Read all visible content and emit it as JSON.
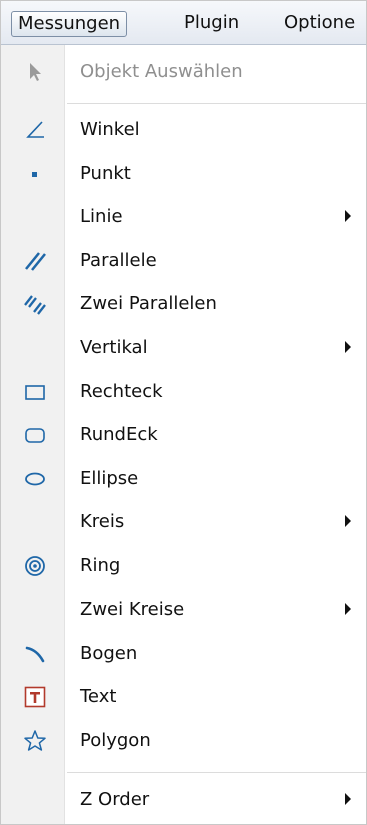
{
  "menubar": {
    "items": [
      "Messungen",
      "Plugin",
      "Optione"
    ]
  },
  "menu": {
    "items": [
      {
        "label": "Objekt Auswählen",
        "icon": "cursor-arrow-icon",
        "disabled": true
      },
      {
        "label": "Winkel",
        "icon": "angle-icon"
      },
      {
        "label": "Punkt",
        "icon": "point-icon"
      },
      {
        "label": "Linie",
        "submenu": true
      },
      {
        "label": "Parallele",
        "icon": "parallel-lines-icon"
      },
      {
        "label": "Zwei Parallelen",
        "icon": "two-parallels-icon"
      },
      {
        "label": "Vertikal",
        "submenu": true
      },
      {
        "label": "Rechteck",
        "icon": "rectangle-icon"
      },
      {
        "label": "RundEck",
        "icon": "rounded-rectangle-icon"
      },
      {
        "label": "Ellipse",
        "icon": "ellipse-icon"
      },
      {
        "label": "Kreis",
        "submenu": true
      },
      {
        "label": "Ring",
        "icon": "ring-icon"
      },
      {
        "label": "Zwei Kreise",
        "submenu": true
      },
      {
        "label": "Bogen",
        "icon": "arc-icon"
      },
      {
        "label": "Text",
        "icon": "text-icon"
      },
      {
        "label": "Polygon",
        "icon": "polygon-star-icon"
      },
      {
        "label": "Z Order",
        "submenu": true
      }
    ]
  },
  "colors": {
    "icon_blue": "#1f67a8",
    "text_icon_red": "#b23a2c",
    "disabled_text": "#8f8f8f"
  }
}
